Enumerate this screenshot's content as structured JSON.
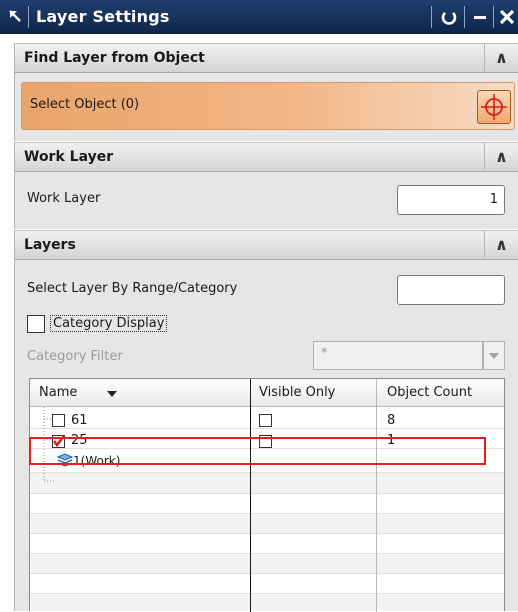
{
  "window": {
    "title": "Layer Settings",
    "buttons": {
      "reset": "reset-icon",
      "minimize": "minimize-icon",
      "close": "close-icon"
    }
  },
  "find_section": {
    "header": "Find Layer from Object",
    "select_label": "Select Object (0)"
  },
  "work_section": {
    "header": "Work Layer",
    "field_label": "Work Layer",
    "value": "1"
  },
  "layers_section": {
    "header": "Layers",
    "range_label": "Select Layer By Range/Category",
    "range_value": "",
    "category_display": {
      "label": "Category Display",
      "checked": false
    },
    "category_filter": {
      "label": "Category Filter",
      "value": "*"
    },
    "columns": {
      "name": "Name",
      "visible_only": "Visible Only",
      "object_count": "Object Count"
    },
    "rows": [
      {
        "name": "61",
        "checked": false,
        "visible_only": false,
        "object_count": "8"
      },
      {
        "name": "25",
        "checked": true,
        "visible_only": false,
        "object_count": "1"
      },
      {
        "name": "1(Work)",
        "object_count": ""
      }
    ]
  },
  "colors": {
    "title_bar": "#12294d",
    "select_highlight": "#f0a56a",
    "selection_outline": "#e02020",
    "checkmark": "#d42020"
  }
}
